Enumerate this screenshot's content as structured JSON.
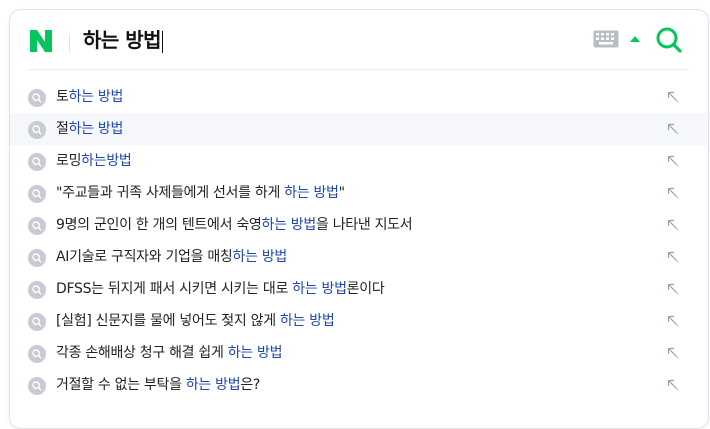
{
  "search": {
    "query": "하는 방법",
    "logo_letter": "N"
  },
  "colors": {
    "brand": "#03c75a",
    "highlight": "#1f47b0",
    "icon_gray": "#c8ccd2"
  },
  "suggestions": [
    {
      "pre": "토",
      "hl": "하는 방법",
      "post": ""
    },
    {
      "pre": "절",
      "hl": "하는 방법",
      "post": ""
    },
    {
      "pre": "로밍",
      "hl": "하는방법",
      "post": ""
    },
    {
      "pre": "\"주교들과 귀족 사제들에게 선서를 하게 ",
      "hl": "하는 방법",
      "post": "\""
    },
    {
      "pre": "9명의 군인이 한 개의 텐트에서 숙영",
      "hl": "하는 방법",
      "post": "을 나타낸 지도서"
    },
    {
      "pre": "AI기술로 구직자와 기업을 매칭",
      "hl": "하는 방법",
      "post": ""
    },
    {
      "pre": "DFSS는 뒤지게 패서 시키면 시키는 대로 ",
      "hl": "하는 방법",
      "post": "론이다"
    },
    {
      "pre": "[실험] 신문지를 물에 넣어도 젖지 않게 ",
      "hl": "하는 방법",
      "post": ""
    },
    {
      "pre": "각종 손해배상 청구 해결 쉽게 ",
      "hl": "하는 방법",
      "post": ""
    },
    {
      "pre": "거절할 수 없는 부탁을 ",
      "hl": "하는 방법",
      "post": "은?"
    }
  ]
}
